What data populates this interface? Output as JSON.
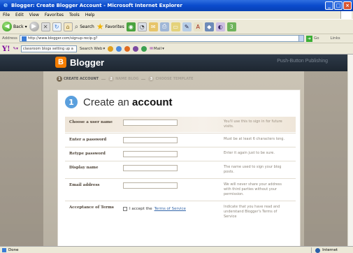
{
  "window": {
    "title": "Blogger: Create Blogger Account - Microsoft Internet Explorer"
  },
  "menu": [
    "File",
    "Edit",
    "View",
    "Favorites",
    "Tools",
    "Help"
  ],
  "toolbar": {
    "back_label": "Back",
    "search_label": "Search",
    "favorites_label": "Favorites"
  },
  "address": {
    "label": "Address",
    "url": "http://www.blogger.com/signup-recip.g?",
    "go_label": "Go",
    "links_label": "Links"
  },
  "yahoo_toolbar": {
    "logo": "Y!",
    "search_text": "classroom blogs setting up a",
    "search_web_label": "Search Web",
    "mail_label": "Mail"
  },
  "page": {
    "logo_text": "Blogger",
    "header_right": "Push-Button Publishing",
    "steps": [
      {
        "num": "1",
        "label": "CREATE ACCOUNT"
      },
      {
        "num": "2",
        "label": "NAME BLOG"
      },
      {
        "num": "3",
        "label": "CHOOSE TEMPLATE"
      }
    ],
    "heading_num": "1",
    "heading_plain": "Create an",
    "heading_bold": "account",
    "fields": [
      {
        "label": "Choose a user name",
        "hint": "You'll use this to sign in for future visits."
      },
      {
        "label": "Enter a password",
        "hint": "Must be at least 6 characters long."
      },
      {
        "label": "Retype password",
        "hint": "Enter it again just to be sure."
      },
      {
        "label": "Display name",
        "hint": "The name used to sign your blog posts."
      },
      {
        "label": "Email address",
        "hint": "We will never share your address with third parties without your permission."
      }
    ],
    "terms": {
      "label": "Acceptance of Terms",
      "checkbox_prefix": "I accept the",
      "link_text": "Terms of Service",
      "hint": "Indicate that you have read and understand Blogger's Terms of Service"
    }
  },
  "status": {
    "left": "Done",
    "zone": "Internet"
  }
}
